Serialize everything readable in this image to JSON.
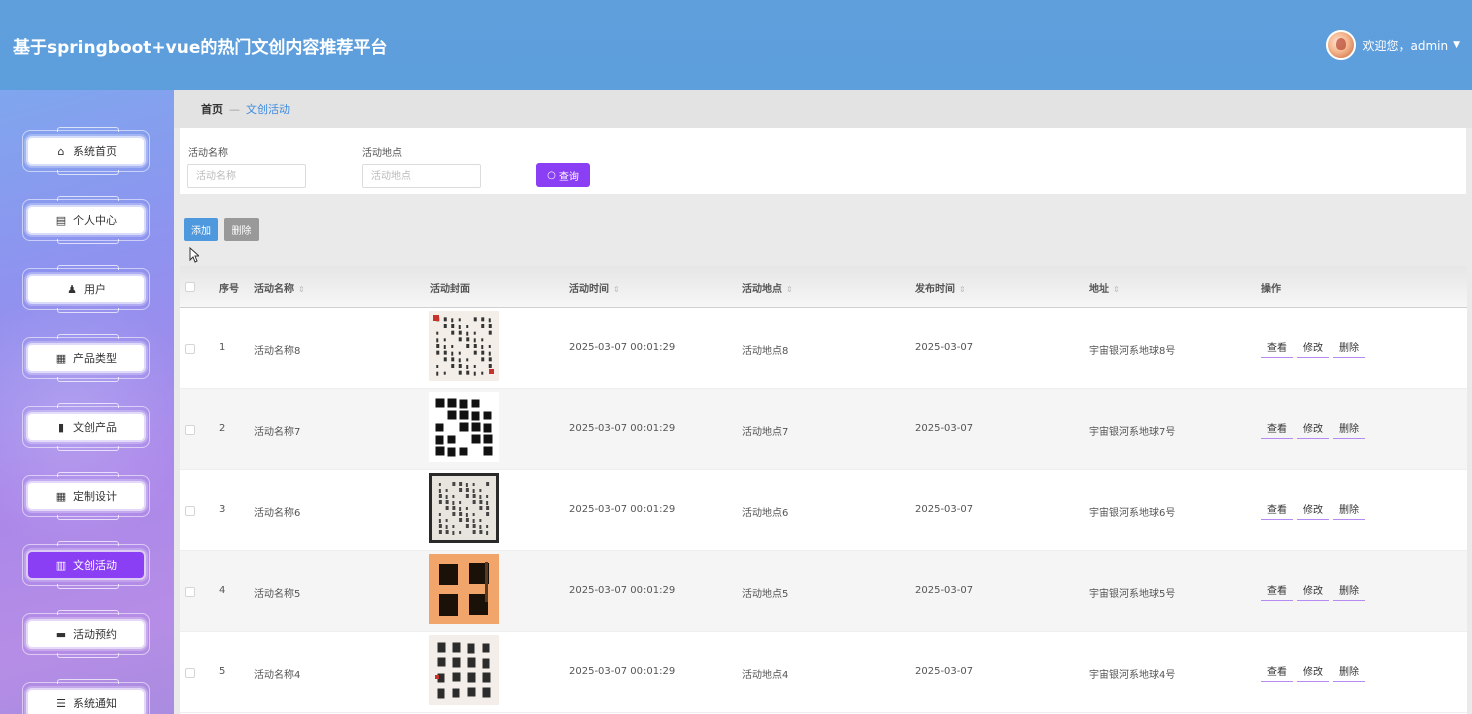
{
  "header": {
    "title": "基于springboot+vue的热门文创内容推荐平台",
    "welcome": "欢迎您，admin"
  },
  "sidebar": {
    "items": [
      {
        "label": "系统首页",
        "icon": "home-icon",
        "glyph": "⌂"
      },
      {
        "label": "个人中心",
        "icon": "card-icon",
        "glyph": "▤"
      },
      {
        "label": "用户",
        "icon": "user-icon",
        "glyph": "♟"
      },
      {
        "label": "产品类型",
        "icon": "grid-icon",
        "glyph": "▦"
      },
      {
        "label": "文创产品",
        "icon": "doc-icon",
        "glyph": "▮"
      },
      {
        "label": "定制设计",
        "icon": "grid-icon",
        "glyph": "▦"
      },
      {
        "label": "文创活动",
        "icon": "bar-chart-icon",
        "glyph": "▥"
      },
      {
        "label": "活动预约",
        "icon": "chat-icon",
        "glyph": "▬"
      },
      {
        "label": "系统通知",
        "icon": "list-icon",
        "glyph": "☰"
      }
    ],
    "active_index": 6
  },
  "breadcrumb": {
    "home": "首页",
    "separator": "—",
    "current": "文创活动"
  },
  "search": {
    "name_label": "活动名称",
    "name_placeholder": "活动名称",
    "place_label": "活动地点",
    "place_placeholder": "活动地点",
    "query_label": "查询"
  },
  "actions": {
    "add_label": "添加",
    "delete_label": "删除"
  },
  "table": {
    "columns": {
      "index": "序号",
      "name": "活动名称",
      "cover": "活动封面",
      "time": "活动时间",
      "place": "活动地点",
      "publish": "发布时间",
      "address": "地址",
      "ops": "操作"
    },
    "op_labels": {
      "view": "查看",
      "edit": "修改",
      "delete": "删除"
    },
    "rows": [
      {
        "index": "1",
        "name": "活动名称8",
        "time": "2025-03-07 00:01:29",
        "place": "活动地点8",
        "publish": "2025-03-07",
        "address": "宇宙银河系地球8号",
        "cover": "calligraphy-scroll-red-seal"
      },
      {
        "index": "2",
        "name": "活动名称7",
        "time": "2025-03-07 00:01:29",
        "place": "活动地点7",
        "publish": "2025-03-07",
        "address": "宇宙银河系地球7号",
        "cover": "calligraphy-black-bold"
      },
      {
        "index": "3",
        "name": "活动名称6",
        "time": "2025-03-07 00:01:29",
        "place": "活动地点6",
        "publish": "2025-03-07",
        "address": "宇宙银河系地球6号",
        "cover": "calligraphy-framed"
      },
      {
        "index": "4",
        "name": "活动名称5",
        "time": "2025-03-07 00:01:29",
        "place": "活动地点5",
        "publish": "2025-03-07",
        "address": "宇宙银河系地球5号",
        "cover": "calligraphy-orange"
      },
      {
        "index": "5",
        "name": "活动名称4",
        "time": "2025-03-07 00:01:29",
        "place": "活动地点4",
        "publish": "2025-03-07",
        "address": "宇宙银河系地球4号",
        "cover": "calligraphy-light"
      }
    ]
  },
  "colors": {
    "header_bg": "#5e9fdc",
    "accent_purple": "#8a3ff5",
    "add_blue": "#4e98dd",
    "delete_gray": "#999999"
  }
}
